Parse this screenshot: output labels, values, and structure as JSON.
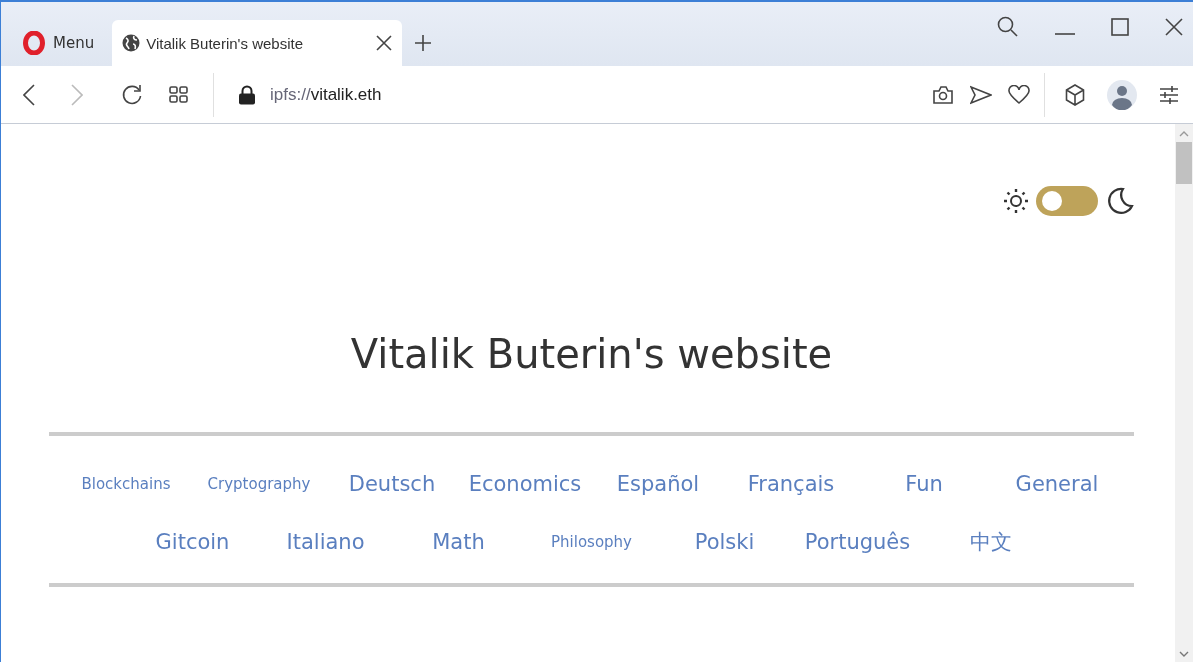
{
  "browser": {
    "menu_label": "Menu",
    "tabs": [
      {
        "title": "Vitalik Buterin's website",
        "selected": true
      }
    ],
    "address": {
      "scheme": "ipfs://",
      "host": "vitalik.eth"
    }
  },
  "theme_toggle": {
    "on": false
  },
  "page": {
    "title": "Vitalik Buterin's website",
    "categories": [
      {
        "label": "Blockchains",
        "kind": "small"
      },
      {
        "label": "Cryptography",
        "kind": "small"
      },
      {
        "label": "Deutsch",
        "kind": "large"
      },
      {
        "label": "Economics",
        "kind": "large"
      },
      {
        "label": "Español",
        "kind": "large"
      },
      {
        "label": "Français",
        "kind": "large"
      },
      {
        "label": "Fun",
        "kind": "large"
      },
      {
        "label": "General",
        "kind": "large"
      },
      {
        "label": "Gitcoin",
        "kind": "large"
      },
      {
        "label": "Italiano",
        "kind": "large"
      },
      {
        "label": "Math",
        "kind": "large"
      },
      {
        "label": "Philosophy",
        "kind": "small"
      },
      {
        "label": "Polski",
        "kind": "large"
      },
      {
        "label": "Português",
        "kind": "large"
      },
      {
        "label": "中文",
        "kind": "large"
      }
    ]
  }
}
